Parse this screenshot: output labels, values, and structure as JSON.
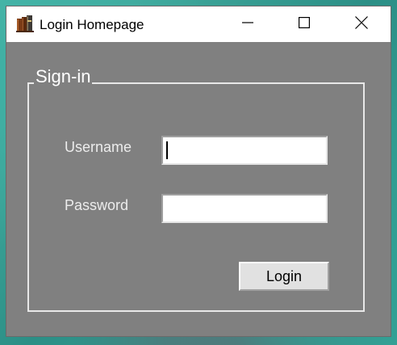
{
  "window": {
    "title": "Login Homepage",
    "icon": "books-icon",
    "controls": {
      "minimize": "minimize-icon",
      "maximize": "maximize-icon",
      "close": "close-icon"
    }
  },
  "form": {
    "group_label": "Sign-in",
    "username_label": "Username",
    "username_value": "",
    "password_label": "Password",
    "password_value": "",
    "login_label": "Login"
  },
  "colors": {
    "client_background": "#808080",
    "titlebar_background": "#ffffff",
    "label_text": "#ececec",
    "button_face": "#e1e1e1"
  }
}
